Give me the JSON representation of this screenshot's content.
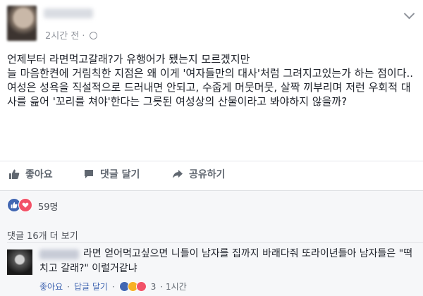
{
  "post": {
    "author": "",
    "time": "2시간 전 ·",
    "paragraph1": "언제부터 라면먹고갈래?가 유행어가 됐는지 모르겠지만\n늘 마음한켠에 거림칙한 지점은 왜 이게 '여자들만의 대사'처럼 그려지고있는가 하는 점이다..",
    "paragraph2": "여성은 성욕을 직설적으로 드러내면 안되고, 수줍게 머뭇머뭇, 살짝 끼부리며 저런 우회적 대사를 읊어 '꼬리를 쳐야'한다는 그릇된 여성상의 산물이라고 봐야하지 않을까?"
  },
  "actions": {
    "like": "좋아요",
    "comment": "댓글 달기",
    "share": "공유하기"
  },
  "reactions": {
    "count": "59명"
  },
  "comments": {
    "more": "댓글 16개 더 보기",
    "item": {
      "author": "",
      "text": "라면 얻어먹고싶으면 니들이 남자를 집까지 바래다줘 또라이년들아 남자들은 \"떡치고 갈래?\" 이럴거같냐",
      "like": "좋아요",
      "reply": "답글 달기",
      "reaction_count": "3",
      "time": "· 1시간"
    }
  },
  "colors": {
    "accent": "#4267b2",
    "love": "#f25268",
    "muted": "#90949c"
  }
}
